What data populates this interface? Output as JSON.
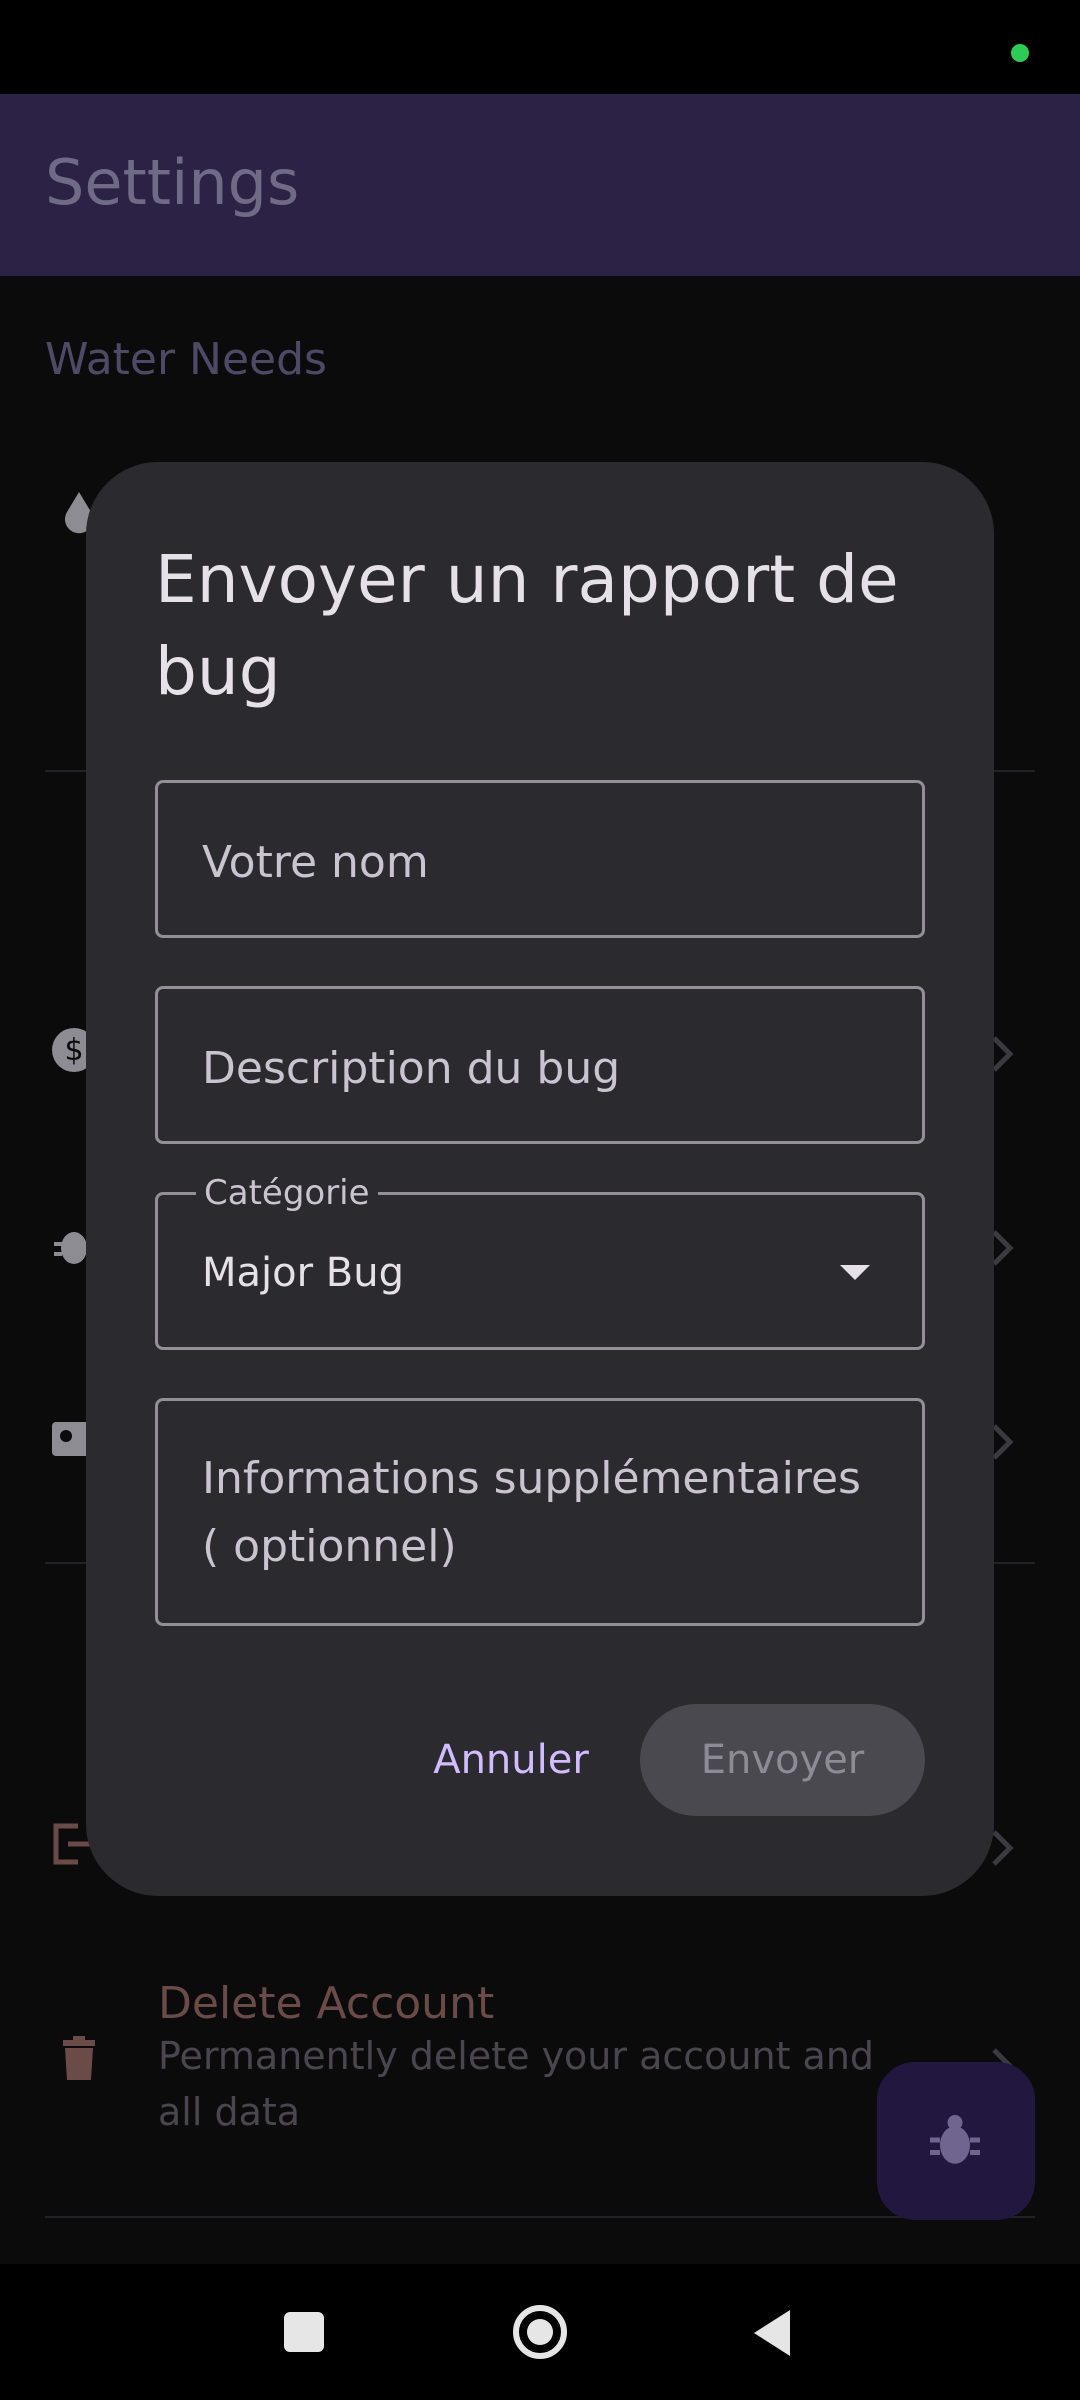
{
  "app_bar": {
    "title": "Settings"
  },
  "settings": {
    "section_water": "Water Needs",
    "delete_account": {
      "title": "Delete Account",
      "subtitle": "Permanently delete your account and all data"
    }
  },
  "dialog": {
    "title": "Envoyer un rapport de bug",
    "name_placeholder": "Votre nom",
    "description_placeholder": "Description du bug",
    "category": {
      "label": "Catégorie",
      "value": "Major Bug"
    },
    "extra_placeholder": "Informations supplémentaires ( optionnel)",
    "cancel_label": "Annuler",
    "send_label": "Envoyer"
  },
  "icons": {
    "status_dot": "status-dot-icon",
    "fab": "bug-report-icon",
    "nav_recents": "recents-square-icon",
    "nav_home": "home-circle-icon",
    "nav_back": "back-triangle-icon"
  },
  "colors": {
    "app_bar_bg": "#2b2245",
    "dialog_bg": "#2b2a2f",
    "accent": "#d0bcff",
    "delete_accent": "#6b4b47"
  }
}
